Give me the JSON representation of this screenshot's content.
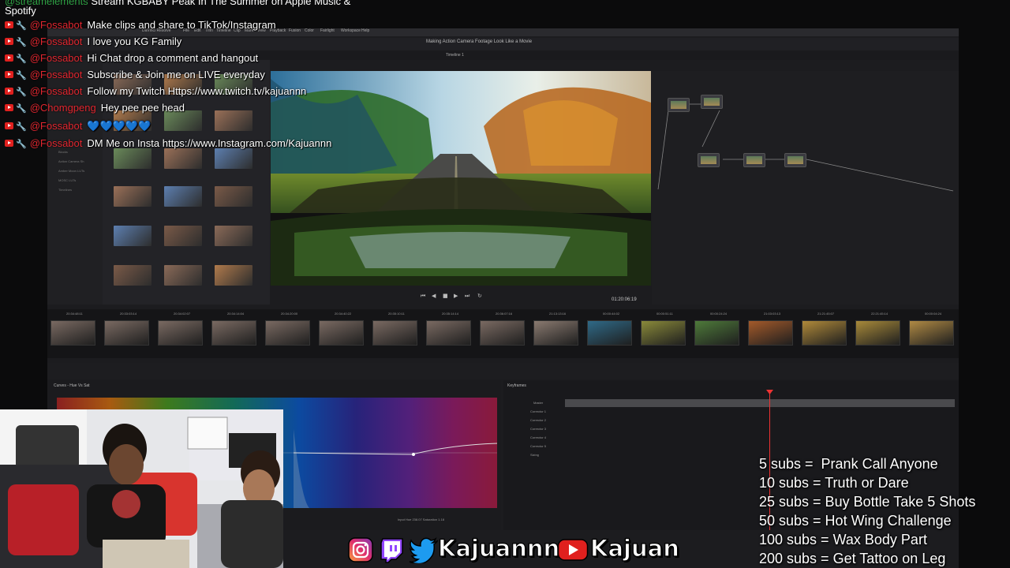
{
  "chat": {
    "top_partial": {
      "user": "@streamelements",
      "text": "Stream KGBABY Peak In The Summer on Apple Music &"
    },
    "top_continuation": "Spotify",
    "messages": [
      {
        "user": "@Fossabot",
        "text": "Make clips and share to TikTok/Instagram"
      },
      {
        "user": "@Fossabot",
        "text": "I love you KG Family"
      },
      {
        "user": "@Fossabot",
        "text": "Hi Chat drop a comment and hangout"
      },
      {
        "user": "@Fossabot",
        "text": "Subscribe & Join me on LIVE everyday"
      },
      {
        "user": "@Fossabot",
        "text": "Follow my Twitch Https://www.twitch.tv/kajuannn"
      },
      {
        "user": "@Chomgpeng",
        "text": "Hey pee pee head"
      },
      {
        "user": "@Fossabot",
        "text": "💙💙💙💙💙"
      },
      {
        "user": "@Fossabot",
        "text": "DM Me on Insta https://www.Instagram.com/Kajuannn"
      }
    ]
  },
  "editor": {
    "project_title": "Making Action Camera Footage Look Like a Movie",
    "menu": [
      "DaVinci Resolve",
      "File",
      "Edit",
      "Trim",
      "Timeline",
      "Clip",
      "Mark",
      "View",
      "Playback",
      "Fusion",
      "Color",
      "Fairlight",
      "Workspace",
      "Help"
    ],
    "timeline_label": "Timeline 1",
    "timecode": "01:20:06:19",
    "sidebar_items": [
      "Master",
      "Blocks",
      "Action Camera Sh",
      "Amber Moon LUTs",
      "MOSC LUTs",
      "Timelines"
    ],
    "curves_title": "Curves - Hue Vs Sat",
    "hue_label": "Input Hue 238.07   Saturation 1.18",
    "keyframes_title": "Keyframes",
    "keyframe_rows": [
      "Master",
      "Corrector 1",
      "Corrector 2",
      "Corrector 3",
      "Corrector 4",
      "Corrector 5",
      "Sizing"
    ],
    "clip_timecodes": [
      "20:34:48:11",
      "20:33:03:14",
      "20:34:02:07",
      "20:34:14:04",
      "20:34:20:00",
      "20:34:40:22",
      "20:35:10:11",
      "20:35:14:14",
      "20:36:07:16",
      "21:13:13:16",
      "00:00:44:02",
      "00:00:51:11",
      "00:00:24:24",
      "21:03:03:13",
      "21:21:45:07",
      "22:21:45:14",
      "00:00:04:24"
    ]
  },
  "sub_goals": [
    "5 subs =  Prank Call Anyone",
    "10 subs = Truth or Dare",
    "25 subs = Buy Bottle Take 5 Shots",
    "50 subs = Hot Wing Challenge",
    "100 subs = Wax Body Part",
    "200 subs = Get Tattoo on Leg"
  ],
  "socials": {
    "handle_1": "Kajuannn",
    "handle_2": "Kajuan",
    "icons": [
      "instagram-icon",
      "twitch-icon",
      "twitter-icon",
      "youtube-icon"
    ]
  },
  "colors": {
    "chat_user": "#e0262f",
    "chat_message": "#ffffff",
    "youtube_red": "#e0201e",
    "twitch_purple": "#9146ff",
    "twitter_blue": "#1d9bf0"
  }
}
